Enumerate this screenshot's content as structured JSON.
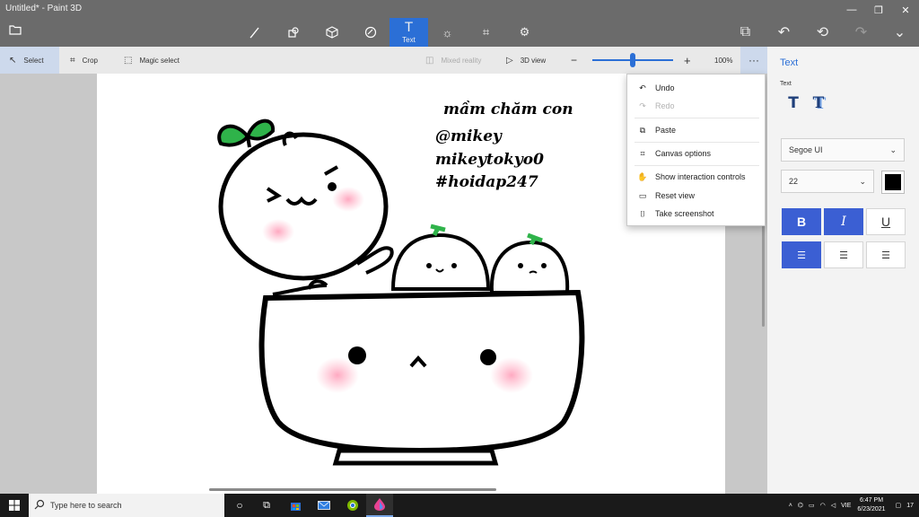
{
  "window": {
    "title": "Untitled* - Paint 3D"
  },
  "toolbar": {
    "active_tool_label": "Text",
    "tools": [
      "brushes-icon",
      "2d-shapes-icon",
      "3d-shapes-icon",
      "stickers-icon",
      "text-icon",
      "effects-icon",
      "canvas-icon",
      "3d-library-icon"
    ]
  },
  "subbar": {
    "select": "Select",
    "crop": "Crop",
    "magic_select": "Magic select",
    "mixed_reality": "Mixed reality",
    "view_3d": "3D view",
    "zoom": "100%",
    "zoom_level": 0.5,
    "more": "···"
  },
  "menu": {
    "undo": "Undo",
    "redo": "Redo",
    "paste": "Paste",
    "canvas_options": "Canvas options",
    "show_interaction": "Show interaction controls",
    "reset_view": "Reset view",
    "take_screenshot": "Take screenshot"
  },
  "canvas": {
    "line1": "mầm chăm con",
    "line2": "@mikey",
    "line3": "mikeytokyo0",
    "line4": "#hoidap247"
  },
  "panel": {
    "title": "Text",
    "subtitle": "Text",
    "font_family": "Segoe UI",
    "font_size": "22",
    "text_color": "#000000",
    "bold_label": "B",
    "italic_label": "I",
    "underline_label": "U"
  },
  "taskbar": {
    "search_placeholder": "Type here to search",
    "language": "VIE",
    "time": "6:47 PM",
    "date": "6/23/2021",
    "notification_count": "17"
  },
  "colors": {
    "accent": "#2b6fd6",
    "sprout": "#2fb34a",
    "blush": "#ffb3c6"
  }
}
